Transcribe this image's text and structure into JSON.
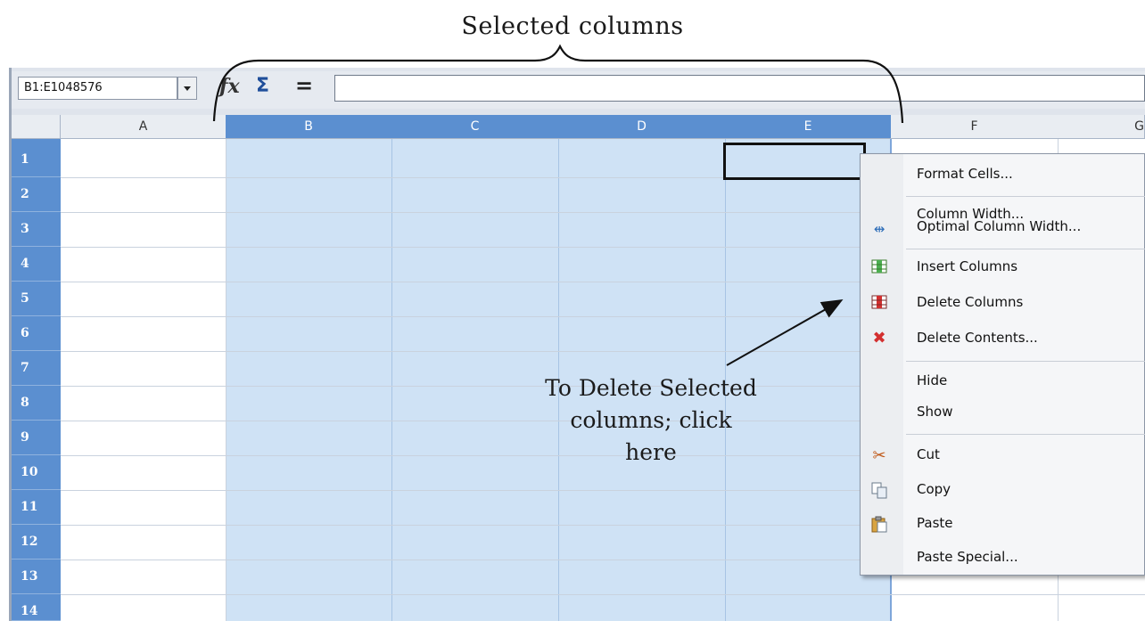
{
  "caption": {
    "selected_columns": "Selected columns",
    "delete_note": [
      "To Delete Selected",
      "columns; click",
      "here"
    ]
  },
  "toolbar": {
    "name_box": "B1:E1048576",
    "fx_icon": "function-wizard-icon",
    "sum_icon": "sum-icon",
    "equals_icon": "equals-icon",
    "formula_value": ""
  },
  "columns": [
    {
      "label": "A",
      "selected": false
    },
    {
      "label": "B",
      "selected": true
    },
    {
      "label": "C",
      "selected": true
    },
    {
      "label": "D",
      "selected": true
    },
    {
      "label": "E",
      "selected": true
    },
    {
      "label": "F",
      "selected": false
    },
    {
      "label": "G",
      "selected": false
    }
  ],
  "rows": [
    "1",
    "2",
    "3",
    "4",
    "5",
    "6",
    "7",
    "8",
    "9",
    "10",
    "11",
    "12",
    "13",
    "14"
  ],
  "context_menu": {
    "items": [
      {
        "label": "Format Cells...",
        "icon": ""
      },
      {
        "label": "Column Width...",
        "icon": ""
      },
      {
        "label": "Optimal Column Width...",
        "icon": "optimal-width-icon"
      },
      {
        "label": "Insert Columns",
        "icon": "insert-columns-icon"
      },
      {
        "label": "Delete Columns",
        "icon": "delete-columns-icon"
      },
      {
        "label": "Delete Contents...",
        "icon": "delete-contents-icon"
      },
      {
        "label": "Hide",
        "icon": ""
      },
      {
        "label": "Show",
        "icon": ""
      },
      {
        "label": "Cut",
        "icon": "scissors-icon"
      },
      {
        "label": "Copy",
        "icon": "copy-icon"
      },
      {
        "label": "Paste",
        "icon": "paste-icon"
      },
      {
        "label": "Paste Special...",
        "icon": ""
      }
    ]
  },
  "colors": {
    "selection_fill": "#cfe2f5",
    "header_selected": "#5b8fd0",
    "menu_bg": "#f5f6f8"
  }
}
